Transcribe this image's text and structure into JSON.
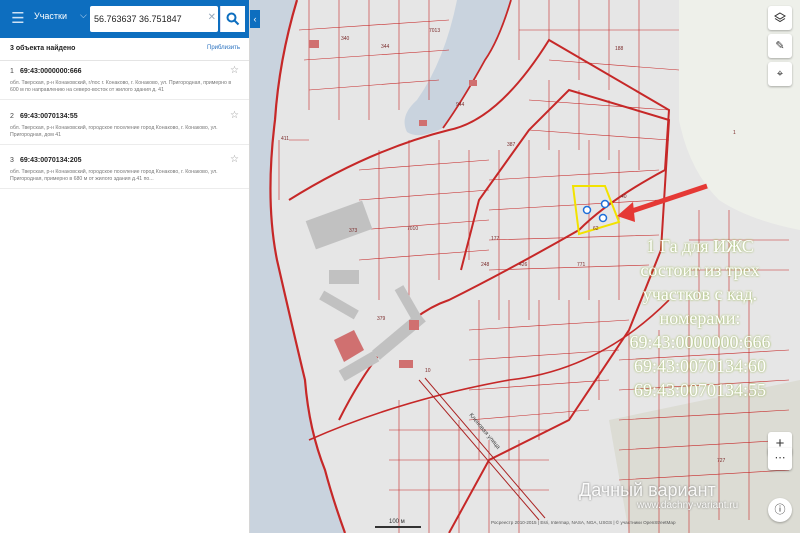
{
  "search": {
    "type_label": "Участки",
    "query": "56.763637 36.751847"
  },
  "results": {
    "found_label": "3 объекта найдено",
    "zoom_label": "Приблизить",
    "items": [
      {
        "num": "1",
        "title": "69:43:0000000:666",
        "address": "обл. Тверская, р-н Конаковский, г/пос г. Конаково, г. Конаково, ул. Пригородная, примерно в 600 м по направлению на северо-восток от жилого здания д. 41"
      },
      {
        "num": "2",
        "title": "69:43:0070134:55",
        "address": "обл. Тверская, р-н Конаковский, городское поселение город Конаково, г. Конаково, ул. Пригородная, дом 41"
      },
      {
        "num": "3",
        "title": "69:43:0070134:205",
        "address": "обл. Тверская, р-н Конаковский, городское поселение город Конаково, г. Конаково, ул. Пригородная, примерно в 680 м от жилого здания д.41 по..."
      }
    ]
  },
  "map": {
    "street_label": "Кленовая улица",
    "scale_label": "100 м",
    "attribution": "Росреестр 2010-2015 | Esri, Intermap, NASA, NGA, USGS | © участники OpenStreetMap",
    "overlay_lines": [
      "1 Га для ИЖС",
      "состоит из трех",
      "участков с кад.",
      "номерами:",
      "69:43:0000000:666",
      "69:43:0070134:60",
      "69:43:0070134:55"
    ],
    "watermark_title": "Дачный вариант",
    "watermark_url": "www.dachny-variant.ru",
    "parcel_labels": [
      "340",
      "344",
      "7013",
      "188",
      "1",
      "944",
      "387",
      "411",
      "373",
      "7010",
      "177",
      "426",
      "379",
      "248",
      "10",
      "771",
      "727",
      "40",
      "62"
    ],
    "colors": {
      "header": "#0d6ebf",
      "parcel_line": "#c62828",
      "water": "#c9d3de",
      "pointer": "#e53935",
      "highlight": "#f2e200"
    }
  },
  "icons": {
    "menu": "menu-icon",
    "search": "search-icon",
    "layers": "layers-icon",
    "ruler": "ruler-icon",
    "locate": "locate-icon",
    "zoom_in": "zoom-in-icon",
    "more": "more-icon",
    "info": "info-icon",
    "star": "star-icon"
  }
}
